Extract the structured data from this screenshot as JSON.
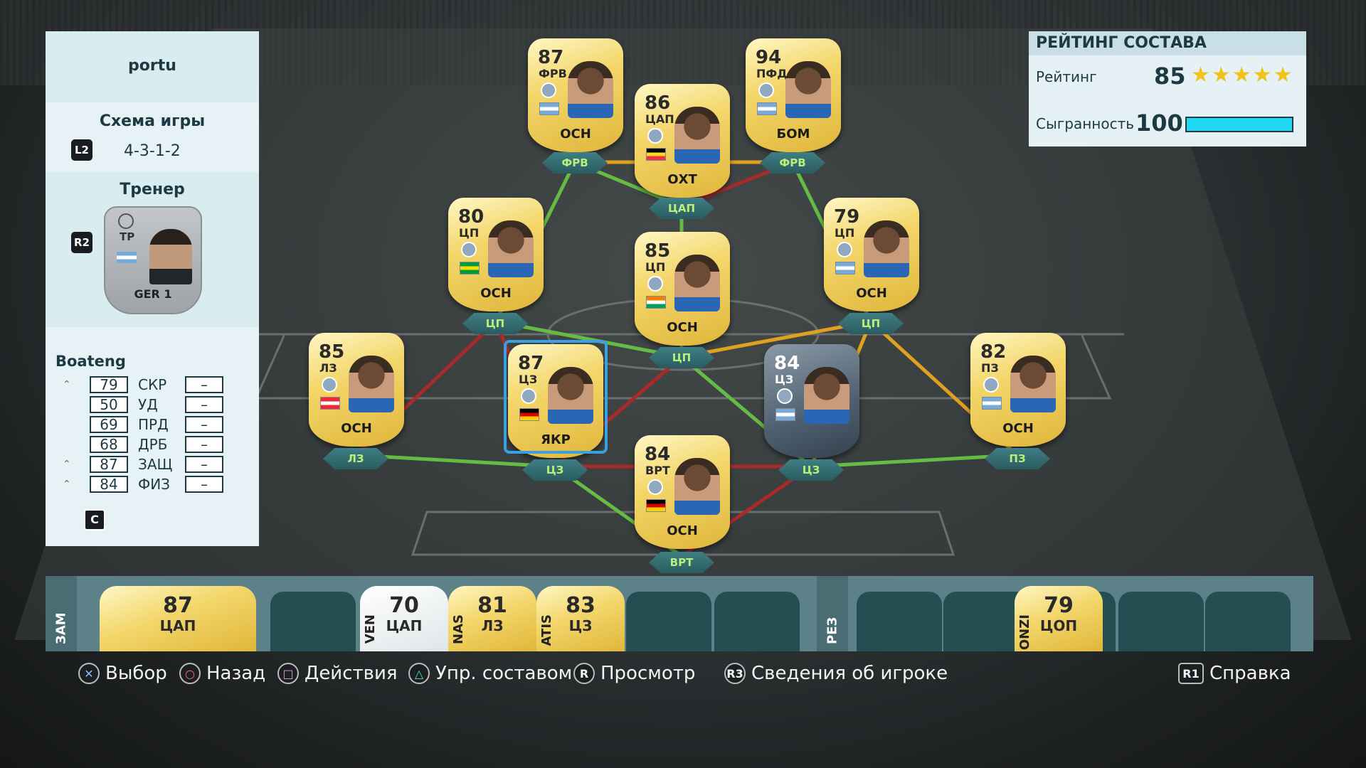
{
  "squad": {
    "name": "portu"
  },
  "formation": {
    "title": "Схема игры",
    "button": "L2",
    "value": "4-3-1-2"
  },
  "manager": {
    "title": "Тренер",
    "button": "R2",
    "position": "ТР",
    "league": "GER 1",
    "flag_colors": [
      "#75aadb",
      "#ffffff",
      "#75aadb"
    ]
  },
  "selected_player": {
    "name": "Boateng",
    "stats": [
      {
        "label": "СКР",
        "value": "79",
        "boost": true,
        "delta": "–"
      },
      {
        "label": "УД",
        "value": "50",
        "boost": false,
        "delta": "–"
      },
      {
        "label": "ПРД",
        "value": "69",
        "boost": false,
        "delta": "–"
      },
      {
        "label": "ДРБ",
        "value": "68",
        "boost": false,
        "delta": "–"
      },
      {
        "label": "ЗАЩ",
        "value": "87",
        "boost": true,
        "delta": "–"
      },
      {
        "label": "ФИЗ",
        "value": "84",
        "boost": true,
        "delta": "–"
      }
    ],
    "button": "C"
  },
  "rating_panel": {
    "title": "РЕЙТИНГ СОСТАВА",
    "rating_label": "Рейтинг",
    "rating": "85",
    "stars": 5,
    "chemistry_label": "Сыгранность",
    "chemistry": "100",
    "chemistry_fraction": 1.0,
    "bar_color": "#1fd7f0"
  },
  "players": [
    {
      "id": "st-left",
      "rating": "87",
      "pos": "ФРВ",
      "chem": "ОСН",
      "slot": "ФРВ",
      "silver": false,
      "flag": [
        "#75aadb",
        "#ffffff",
        "#75aadb"
      ]
    },
    {
      "id": "cam",
      "rating": "86",
      "pos": "ЦАП",
      "chem": "ОХТ",
      "slot": "ЦАП",
      "silver": false,
      "flag": [
        "#000000",
        "#fdda24",
        "#ef3340"
      ]
    },
    {
      "id": "st-right",
      "rating": "94",
      "pos": "ПФД",
      "chem": "БОМ",
      "slot": "ФРВ",
      "silver": false,
      "flag": [
        "#75aadb",
        "#ffffff",
        "#75aadb"
      ]
    },
    {
      "id": "cm-left",
      "rating": "80",
      "pos": "ЦП",
      "chem": "ОСН",
      "slot": "ЦП",
      "silver": false,
      "flag": [
        "#009c3b",
        "#ffdf00",
        "#009c3b"
      ]
    },
    {
      "id": "cm-center",
      "rating": "85",
      "pos": "ЦП",
      "chem": "ОСН",
      "slot": "ЦП",
      "silver": false,
      "flag": [
        "#f77f00",
        "#ffffff",
        "#009e60"
      ]
    },
    {
      "id": "cm-right",
      "rating": "79",
      "pos": "ЦП",
      "chem": "ОСН",
      "slot": "ЦП",
      "silver": false,
      "flag": [
        "#75aadb",
        "#ffffff",
        "#75aadb"
      ]
    },
    {
      "id": "lb",
      "rating": "85",
      "pos": "ЛЗ",
      "chem": "ОСН",
      "slot": "ЛЗ",
      "silver": false,
      "flag": [
        "#ed2939",
        "#ffffff",
        "#ed2939"
      ]
    },
    {
      "id": "cb-left",
      "rating": "87",
      "pos": "ЦЗ",
      "chem": "ЯКР",
      "slot": "ЦЗ",
      "silver": false,
      "flag": [
        "#000000",
        "#dd0000",
        "#ffce00"
      ]
    },
    {
      "id": "cb-right",
      "rating": "84",
      "pos": "ЦЗ",
      "chem": "",
      "slot": "ЦЗ",
      "silver": true,
      "flag": [
        "#75aadb",
        "#ffffff",
        "#75aadb"
      ]
    },
    {
      "id": "rb",
      "rating": "82",
      "pos": "ПЗ",
      "chem": "ОСН",
      "slot": "ПЗ",
      "silver": false,
      "flag": [
        "#75aadb",
        "#ffffff",
        "#75aadb"
      ]
    },
    {
      "id": "gk",
      "rating": "84",
      "pos": "ВРТ",
      "chem": "ОСН",
      "slot": "ВРТ",
      "silver": false,
      "flag": [
        "#000000",
        "#dd0000",
        "#ffce00"
      ]
    }
  ],
  "bench": {
    "subs_label": "ЗАМ",
    "reserves_label": "РЕЗ",
    "cards": [
      {
        "rating": "87",
        "pos": "ЦАП",
        "name": ""
      },
      {
        "rating": "70",
        "pos": "ЦАП",
        "name": "VEN"
      },
      {
        "rating": "81",
        "pos": "ЛЗ",
        "name": "NAS"
      },
      {
        "rating": "83",
        "pos": "ЦЗ",
        "name": "ATIS"
      },
      {
        "rating": "79",
        "pos": "ЦОП",
        "name": "ONZI"
      }
    ]
  },
  "footer": {
    "select": {
      "glyph": "✕",
      "label": "Выбор"
    },
    "back": {
      "glyph": "○",
      "label": "Назад"
    },
    "actions": {
      "glyph": "□",
      "label": "Действия"
    },
    "manage": {
      "glyph": "△",
      "label": "Упр. составом"
    },
    "view": {
      "glyph": "R",
      "label": "Просмотр"
    },
    "info": {
      "glyph": "R3",
      "label": "Сведения об игроке"
    },
    "help": {
      "glyph": "R1",
      "label": "Справка"
    }
  }
}
